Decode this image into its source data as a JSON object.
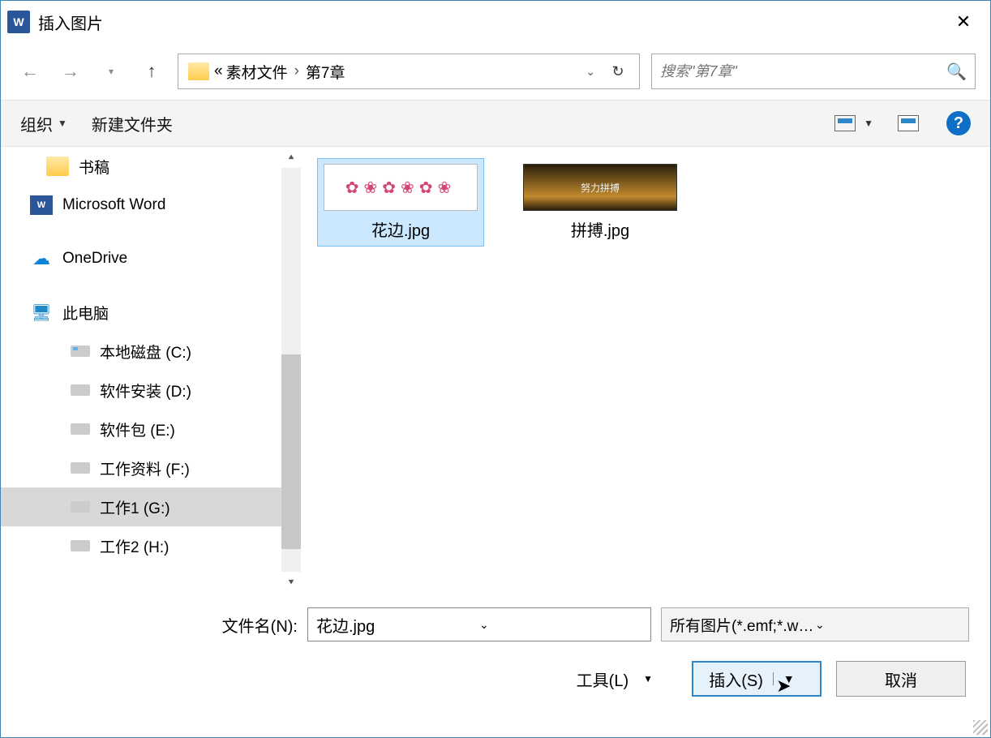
{
  "window": {
    "title": "插入图片"
  },
  "nav": {
    "breadcrumb": {
      "prefix": "«",
      "parent": "素材文件",
      "current": "第7章"
    },
    "search_placeholder": "搜索\"第7章\""
  },
  "toolbar": {
    "organize": "组织",
    "new_folder": "新建文件夹"
  },
  "sidebar": {
    "items": [
      {
        "label": "书稿"
      },
      {
        "label": "Microsoft Word"
      },
      {
        "label": "OneDrive"
      },
      {
        "label": "此电脑"
      },
      {
        "label": "本地磁盘 (C:)"
      },
      {
        "label": "软件安装 (D:)"
      },
      {
        "label": "软件包 (E:)"
      },
      {
        "label": "工作资料 (F:)"
      },
      {
        "label": "工作1 (G:)"
      },
      {
        "label": "工作2 (H:)"
      }
    ]
  },
  "files": [
    {
      "label": "花边.jpg",
      "selected": true
    },
    {
      "label": "拼搏.jpg",
      "selected": false
    }
  ],
  "footer": {
    "filename_label": "文件名(N):",
    "filename_value": "花边.jpg",
    "filetype_value": "所有图片(*.emf;*.wmf;*.jpg;*.jpeg;*.png;*.bmp)",
    "tools": "工具(L)",
    "insert": "插入(S)",
    "cancel": "取消"
  }
}
